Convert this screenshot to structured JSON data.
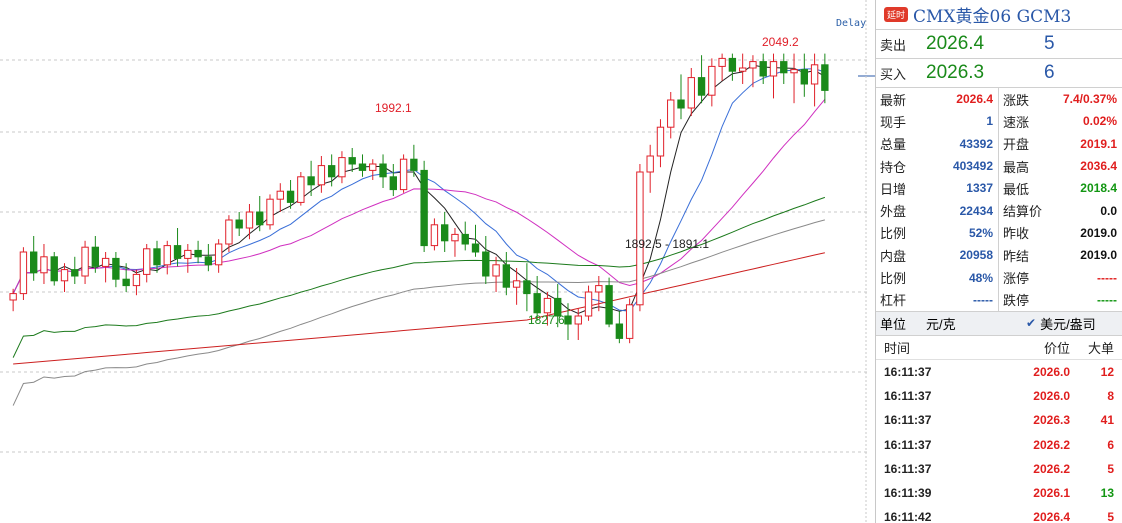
{
  "chart": {
    "delay_label": "Delay",
    "labels": {
      "high": "2049.2",
      "mid_high": "1992.1",
      "low": "1827.6",
      "gap": "1892.5 - 1891.1"
    },
    "colors": {
      "up": "#e0202a",
      "down": "#1a8a1a",
      "ma5": "#222222",
      "ma10": "#3a6fd8",
      "ma20": "#d030c0",
      "ma60": "#1c7a1c",
      "ma120": "#8a8a8a",
      "ma250": "#cc2020"
    }
  },
  "chart_data": {
    "type": "candlestick",
    "ylim": [
      1770,
      2070
    ],
    "grid": "horizontal-dashed",
    "candles": [
      [
        1895,
        1902,
        1888,
        1899
      ],
      [
        1899,
        1928,
        1895,
        1925
      ],
      [
        1925,
        1935,
        1907,
        1912
      ],
      [
        1912,
        1930,
        1905,
        1922
      ],
      [
        1922,
        1925,
        1904,
        1907
      ],
      [
        1907,
        1918,
        1900,
        1914
      ],
      [
        1914,
        1922,
        1905,
        1910
      ],
      [
        1910,
        1932,
        1905,
        1928
      ],
      [
        1928,
        1935,
        1912,
        1916
      ],
      [
        1916,
        1925,
        1906,
        1921
      ],
      [
        1921,
        1925,
        1903,
        1908
      ],
      [
        1908,
        1918,
        1900,
        1904
      ],
      [
        1904,
        1914,
        1898,
        1911
      ],
      [
        1911,
        1930,
        1906,
        1927
      ],
      [
        1927,
        1932,
        1912,
        1917
      ],
      [
        1917,
        1932,
        1911,
        1929
      ],
      [
        1929,
        1940,
        1916,
        1921
      ],
      [
        1921,
        1930,
        1912,
        1926
      ],
      [
        1926,
        1932,
        1918,
        1922
      ],
      [
        1922,
        1930,
        1913,
        1917
      ],
      [
        1917,
        1933,
        1912,
        1930
      ],
      [
        1930,
        1948,
        1925,
        1945
      ],
      [
        1945,
        1950,
        1935,
        1940
      ],
      [
        1940,
        1955,
        1933,
        1950
      ],
      [
        1950,
        1960,
        1938,
        1942
      ],
      [
        1942,
        1961,
        1939,
        1958
      ],
      [
        1958,
        1968,
        1950,
        1963
      ],
      [
        1963,
        1970,
        1952,
        1956
      ],
      [
        1956,
        1975,
        1954,
        1972
      ],
      [
        1972,
        1982,
        1960,
        1967
      ],
      [
        1967,
        1985,
        1962,
        1979
      ],
      [
        1979,
        1986,
        1966,
        1972
      ],
      [
        1972,
        1988,
        1968,
        1984
      ],
      [
        1984,
        1990,
        1975,
        1980
      ],
      [
        1980,
        1986,
        1972,
        1976
      ],
      [
        1976,
        1983,
        1970,
        1980
      ],
      [
        1980,
        1986,
        1965,
        1972
      ],
      [
        1972,
        1980,
        1960,
        1964
      ],
      [
        1964,
        1986,
        1962,
        1983
      ],
      [
        1983,
        1992,
        1972,
        1976
      ],
      [
        1976,
        1982,
        1925,
        1929
      ],
      [
        1929,
        1946,
        1926,
        1942
      ],
      [
        1942,
        1950,
        1925,
        1932
      ],
      [
        1932,
        1940,
        1922,
        1936
      ],
      [
        1936,
        1944,
        1926,
        1930
      ],
      [
        1930,
        1942,
        1922,
        1925
      ],
      [
        1925,
        1935,
        1905,
        1910
      ],
      [
        1910,
        1922,
        1900,
        1917
      ],
      [
        1917,
        1925,
        1898,
        1903
      ],
      [
        1903,
        1915,
        1892,
        1907
      ],
      [
        1907,
        1918,
        1888,
        1899
      ],
      [
        1899,
        1910,
        1882,
        1887
      ],
      [
        1887,
        1900,
        1879,
        1896
      ],
      [
        1896,
        1905,
        1878,
        1885
      ],
      [
        1885,
        1893,
        1870,
        1880
      ],
      [
        1880,
        1890,
        1870,
        1885
      ],
      [
        1885,
        1904,
        1882,
        1900
      ],
      [
        1900,
        1910,
        1888,
        1904
      ],
      [
        1904,
        1909,
        1878,
        1880
      ],
      [
        1880,
        1888,
        1868,
        1871
      ],
      [
        1871,
        1896,
        1868,
        1892
      ],
      [
        1892,
        1980,
        1888,
        1975
      ],
      [
        1975,
        1992,
        1962,
        1985
      ],
      [
        1985,
        2008,
        1978,
        2003
      ],
      [
        2003,
        2025,
        1996,
        2020
      ],
      [
        2020,
        2036,
        2008,
        2015
      ],
      [
        2015,
        2040,
        2010,
        2034
      ],
      [
        2034,
        2048,
        2018,
        2023
      ],
      [
        2023,
        2046,
        2016,
        2041
      ],
      [
        2041,
        2049,
        2032,
        2046
      ],
      [
        2046,
        2049,
        2032,
        2038
      ],
      [
        2038,
        2049,
        2030,
        2040
      ],
      [
        2040,
        2048,
        2028,
        2044
      ],
      [
        2044,
        2049,
        2030,
        2035
      ],
      [
        2035,
        2049,
        2021,
        2044
      ],
      [
        2044,
        2049,
        2030,
        2037
      ],
      [
        2037,
        2049,
        2018,
        2039
      ],
      [
        2039,
        2049,
        2022,
        2030
      ],
      [
        2030,
        2049,
        2016,
        2042
      ],
      [
        2042,
        2049,
        2018,
        2026
      ]
    ]
  },
  "panel": {
    "badge": "延时",
    "title": "CMX黄金06  GCM3",
    "sell_label": "卖出",
    "sell_price": "2026.4",
    "sell_vol": "5",
    "buy_label": "买入",
    "buy_price": "2026.3",
    "buy_vol": "6",
    "stats_left": [
      {
        "k": "最新",
        "v": "2026.4",
        "c": "c-red"
      },
      {
        "k": "现手",
        "v": "1",
        "c": "c-blue"
      },
      {
        "k": "总量",
        "v": "43392",
        "c": "c-blue"
      },
      {
        "k": "持仓",
        "v": "403492",
        "c": "c-blue"
      },
      {
        "k": "日增",
        "v": "1337",
        "c": "c-blue"
      },
      {
        "k": "外盘",
        "v": "22434",
        "c": "c-blue"
      },
      {
        "k": "比例",
        "v": "52%",
        "c": "c-blue"
      },
      {
        "k": "内盘",
        "v": "20958",
        "c": "c-blue"
      },
      {
        "k": "比例",
        "v": "48%",
        "c": "c-blue"
      },
      {
        "k": "杠杆",
        "v": "-----",
        "c": "c-blue"
      }
    ],
    "stats_right": [
      {
        "k": "涨跌",
        "v": "7.4/0.37%",
        "c": "c-red"
      },
      {
        "k": "速涨",
        "v": "0.02%",
        "c": "c-red"
      },
      {
        "k": "开盘",
        "v": "2019.1",
        "c": "c-red"
      },
      {
        "k": "最高",
        "v": "2036.4",
        "c": "c-red"
      },
      {
        "k": "最低",
        "v": "2018.4",
        "c": "c-green"
      },
      {
        "k": "结算价",
        "v": "0.0",
        "c": "c-black"
      },
      {
        "k": "昨收",
        "v": "2019.0",
        "c": "c-black"
      },
      {
        "k": "昨结",
        "v": "2019.0",
        "c": "c-black"
      },
      {
        "k": "涨停",
        "v": "-----",
        "c": "c-red"
      },
      {
        "k": "跌停",
        "v": "-----",
        "c": "c-green"
      }
    ],
    "unit_label": "单位",
    "unit_value": "元/克",
    "unit_option": "美元/盎司",
    "tick_headers": {
      "time": "时间",
      "price": "价位",
      "vol": "大单"
    },
    "ticks": [
      {
        "time": "16:11:37",
        "price": "2026.0",
        "vol": "12",
        "vc": "c-red"
      },
      {
        "time": "16:11:37",
        "price": "2026.0",
        "vol": "8",
        "vc": "c-red"
      },
      {
        "time": "16:11:37",
        "price": "2026.3",
        "vol": "41",
        "vc": "c-red"
      },
      {
        "time": "16:11:37",
        "price": "2026.2",
        "vol": "6",
        "vc": "c-red"
      },
      {
        "time": "16:11:37",
        "price": "2026.2",
        "vol": "5",
        "vc": "c-red"
      },
      {
        "time": "16:11:39",
        "price": "2026.1",
        "vol": "13",
        "vc": "c-green"
      },
      {
        "time": "16:11:42",
        "price": "2026.4",
        "vol": "5",
        "vc": "c-red"
      }
    ]
  }
}
